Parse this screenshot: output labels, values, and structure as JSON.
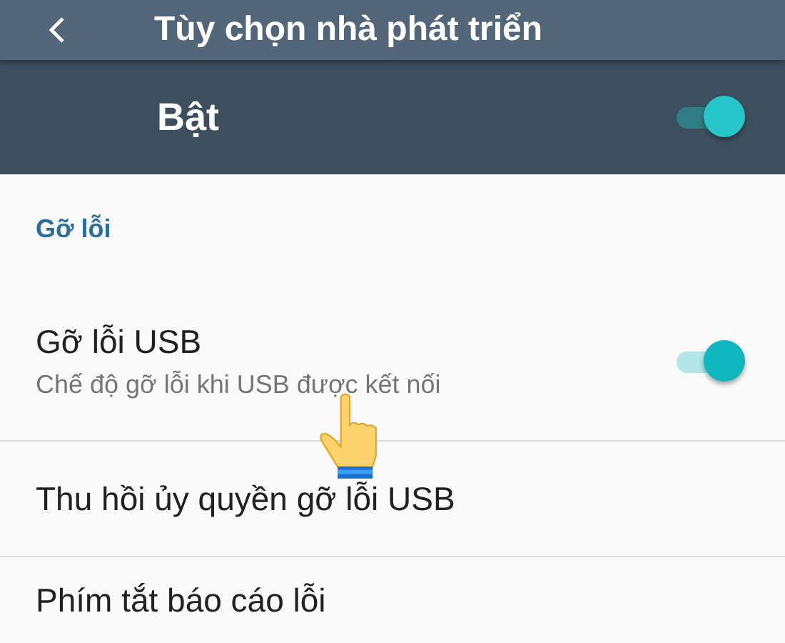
{
  "app_bar": {
    "title": "Tùy chọn nhà phát triển"
  },
  "master_switch": {
    "label": "Bật",
    "on": true
  },
  "section": {
    "title": "Gỡ lỗi"
  },
  "settings": [
    {
      "kind": "switch",
      "title": "Gỡ lỗi USB",
      "summary": "Chế độ gỡ lỗi khi USB được kết nối",
      "on": true
    },
    {
      "kind": "plain",
      "title": "Thu hồi ủy quyền gỡ lỗi USB"
    },
    {
      "kind": "plain",
      "title": "Phím tắt báo cáo lỗi"
    }
  ]
}
